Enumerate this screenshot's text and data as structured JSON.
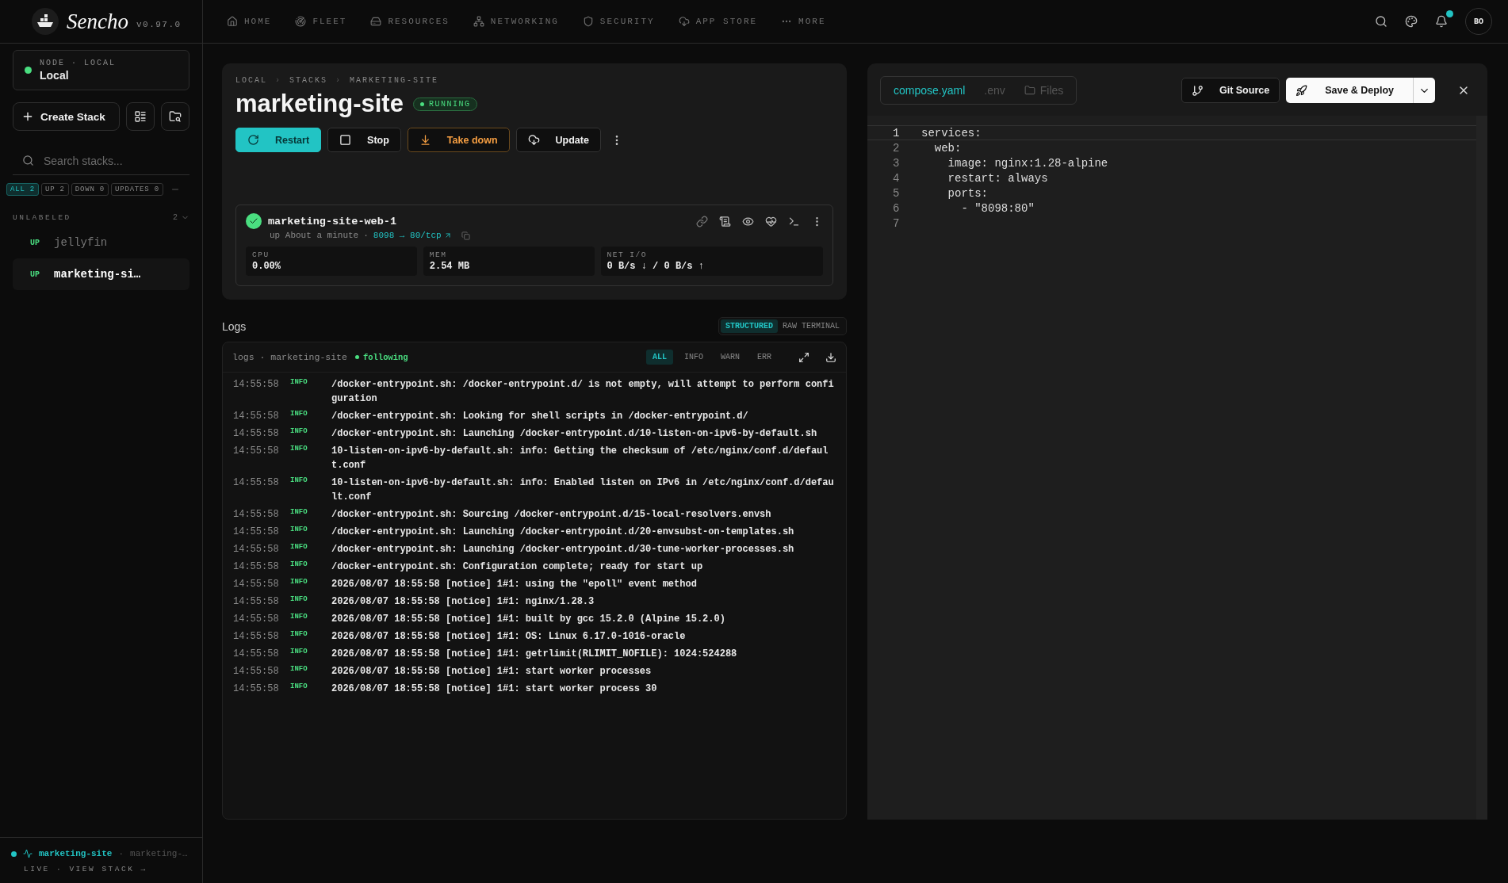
{
  "app": {
    "name": "Sencho",
    "version": "v0.97.0"
  },
  "nav": [
    {
      "label": "HOME"
    },
    {
      "label": "FLEET"
    },
    {
      "label": "RESOURCES"
    },
    {
      "label": "NETWORKING"
    },
    {
      "label": "SECURITY"
    },
    {
      "label": "APP STORE"
    },
    {
      "label": "MORE"
    }
  ],
  "user": {
    "initials": "BO",
    "has_notification": true
  },
  "sidebar": {
    "node": {
      "label": "NODE · LOCAL",
      "name": "Local",
      "online": true
    },
    "create_button": "Create Stack",
    "search": {
      "placeholder": "Search stacks..."
    },
    "filters": [
      {
        "label": "ALL 2",
        "selected": true
      },
      {
        "label": "UP 2",
        "selected": false
      },
      {
        "label": "DOWN 0",
        "selected": false
      },
      {
        "label": "UPDATES 0",
        "selected": false
      }
    ],
    "group": {
      "label": "UNLABELED",
      "count": "2"
    },
    "stacks": [
      {
        "status": "UP",
        "name": "jellyfin",
        "selected": false
      },
      {
        "status": "UP",
        "name": "marketing-si…",
        "selected": true
      }
    ],
    "live": {
      "separator": "·",
      "stack": "marketing-site",
      "container": "marketing-…",
      "action": "LIVE · VIEW STACK →"
    }
  },
  "stack": {
    "breadcrumb_separator": "›",
    "breadcrumb": [
      "LOCAL",
      "STACKS",
      "MARKETING-SITE"
    ],
    "title": "marketing-site",
    "status": "RUNNING",
    "actions": [
      {
        "label": "Restart",
        "kind": "primary"
      },
      {
        "label": "Stop",
        "kind": "default"
      },
      {
        "label": "Take down",
        "kind": "warning"
      },
      {
        "label": "Update",
        "kind": "default"
      }
    ],
    "container": {
      "name": "marketing-site-web-1",
      "healthy": true,
      "uptime": "up About a minute",
      "separator": "·",
      "ports": "8098 → 80/tcp",
      "stats": [
        {
          "label": "CPU",
          "value": "0.00%"
        },
        {
          "label": "MEM",
          "value": "2.54 MB"
        },
        {
          "label": "NET I/O",
          "value": "0 B/s ↓ / 0 B/s ↑"
        }
      ]
    }
  },
  "logs": {
    "title": "Logs",
    "modes": [
      {
        "label": "STRUCTURED",
        "selected": true
      },
      {
        "label": "RAW TERMINAL",
        "selected": false
      }
    ],
    "source": "logs · marketing-site",
    "following": "following",
    "levels": [
      {
        "label": "ALL",
        "selected": true
      },
      {
        "label": "INFO",
        "selected": false
      },
      {
        "label": "WARN",
        "selected": false
      },
      {
        "label": "ERR",
        "selected": false
      }
    ],
    "rows": [
      {
        "time": "14:55:58",
        "level": "INFO",
        "message": "/docker-entrypoint.sh: /docker-entrypoint.d/ is not empty, will attempt to perform configuration"
      },
      {
        "time": "14:55:58",
        "level": "INFO",
        "message": "/docker-entrypoint.sh: Looking for shell scripts in /docker-entrypoint.d/"
      },
      {
        "time": "14:55:58",
        "level": "INFO",
        "message": "/docker-entrypoint.sh: Launching /docker-entrypoint.d/10-listen-on-ipv6-by-default.sh"
      },
      {
        "time": "14:55:58",
        "level": "INFO",
        "message": "10-listen-on-ipv6-by-default.sh: info: Getting the checksum of /etc/nginx/conf.d/default.conf"
      },
      {
        "time": "14:55:58",
        "level": "INFO",
        "message": "10-listen-on-ipv6-by-default.sh: info: Enabled listen on IPv6 in /etc/nginx/conf.d/default.conf"
      },
      {
        "time": "14:55:58",
        "level": "INFO",
        "message": "/docker-entrypoint.sh: Sourcing /docker-entrypoint.d/15-local-resolvers.envsh"
      },
      {
        "time": "14:55:58",
        "level": "INFO",
        "message": "/docker-entrypoint.sh: Launching /docker-entrypoint.d/20-envsubst-on-templates.sh"
      },
      {
        "time": "14:55:58",
        "level": "INFO",
        "message": "/docker-entrypoint.sh: Launching /docker-entrypoint.d/30-tune-worker-processes.sh"
      },
      {
        "time": "14:55:58",
        "level": "INFO",
        "message": "/docker-entrypoint.sh: Configuration complete; ready for start up"
      },
      {
        "time": "14:55:58",
        "level": "INFO",
        "message": "2026/08/07 18:55:58 [notice] 1#1: using the \"epoll\" event method"
      },
      {
        "time": "14:55:58",
        "level": "INFO",
        "message": "2026/08/07 18:55:58 [notice] 1#1: nginx/1.28.3"
      },
      {
        "time": "14:55:58",
        "level": "INFO",
        "message": "2026/08/07 18:55:58 [notice] 1#1: built by gcc 15.2.0 (Alpine 15.2.0)"
      },
      {
        "time": "14:55:58",
        "level": "INFO",
        "message": "2026/08/07 18:55:58 [notice] 1#1: OS: Linux 6.17.0-1016-oracle"
      },
      {
        "time": "14:55:58",
        "level": "INFO",
        "message": "2026/08/07 18:55:58 [notice] 1#1: getrlimit(RLIMIT_NOFILE): 1024:524288"
      },
      {
        "time": "14:55:58",
        "level": "INFO",
        "message": "2026/08/07 18:55:58 [notice] 1#1: start worker processes"
      },
      {
        "time": "14:55:58",
        "level": "INFO",
        "message": "2026/08/07 18:55:58 [notice] 1#1: start worker process 30"
      }
    ]
  },
  "editor": {
    "tabs": [
      {
        "label": "compose.yaml",
        "selected": true
      },
      {
        "label": ".env",
        "selected": false
      },
      {
        "label": "Files",
        "selected": false
      }
    ],
    "git_button": "Git Source",
    "deploy_button": "Save & Deploy",
    "lines": [
      {
        "number": "1",
        "code": "services:",
        "active": true
      },
      {
        "number": "2",
        "code": "  web:",
        "active": false
      },
      {
        "number": "3",
        "code": "    image: nginx:1.28-alpine",
        "active": false
      },
      {
        "number": "4",
        "code": "    restart: always",
        "active": false
      },
      {
        "number": "5",
        "code": "    ports:",
        "active": false
      },
      {
        "number": "6",
        "code": "      - \"8098:80\"",
        "active": false
      },
      {
        "number": "7",
        "active": false
      }
    ]
  }
}
